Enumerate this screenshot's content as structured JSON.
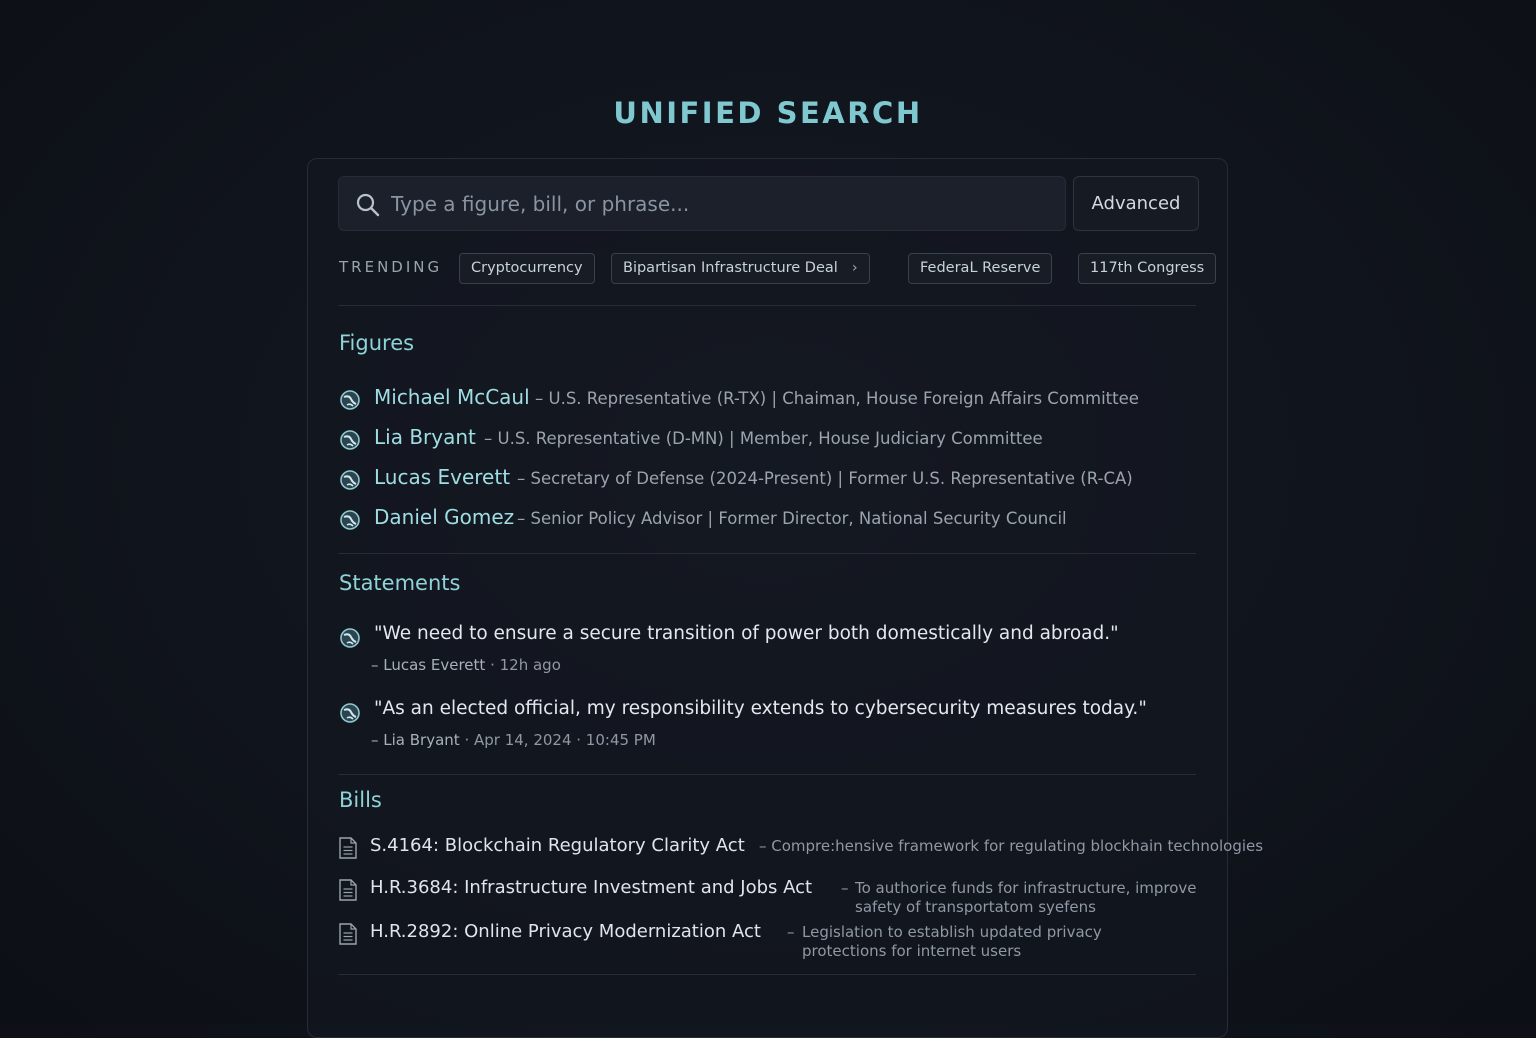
{
  "page": {
    "title": "UNIFIED SEARCH"
  },
  "search": {
    "placeholder": "Type a figure, bill, or phrase...",
    "value": "",
    "advanced_label": "Advanced"
  },
  "trending": {
    "label": "TRENDING",
    "chips": [
      {
        "label": "Cryptocurrency"
      },
      {
        "label": "Bipartisan Infrastructure Deal",
        "chevron": "›"
      },
      {
        "label": "FederaL Reserve"
      },
      {
        "label": "117th Congress"
      }
    ]
  },
  "figures": {
    "title": "Figures",
    "items": [
      {
        "name": "Michael McCaul",
        "desc": "– U.S. Representative (R-TX)  |  Chaiman, House Foreign Affairs Committee"
      },
      {
        "name": "Lia Bryant",
        "desc": "– U.S. Representative (D-MN)  |  Member, House Judiciary Committee"
      },
      {
        "name": "Lucas Everett",
        "desc": "– Secretary of Defense (2024-Present)  |  Former U.S. Representative (R-CA)"
      },
      {
        "name": "Daniel Gomez",
        "desc": "– Senior Policy Advisor  |  Former Director, National Security Council"
      }
    ]
  },
  "statements": {
    "title": "Statements",
    "items": [
      {
        "quote": "\"We need to ensure a secure transition of power both domestically and abroad.\"",
        "author": "– Lucas Everett",
        "time": "·  12h ago"
      },
      {
        "quote": "\"As an elected official, my responsibility extends to cybersecurity measures today.\"",
        "author": "– Lia Bryant",
        "time": "·  Apr 14, 2024 · 10:45 PM"
      }
    ]
  },
  "bills": {
    "title": "Bills",
    "items": [
      {
        "title": "S.4164: Blockchain Regulatory Clarity Act",
        "desc": "– Compre:hensive framework for regulating blockhain technologies"
      },
      {
        "title": "H.R.3684: Infrastructure Investment and Jobs Act",
        "desc_dash": "–",
        "desc_line1": "To authorice funds for infrastructure, improve",
        "desc_line2": "safety of transportatom syefens"
      },
      {
        "title": "H.R.2892: Online Privacy Modernization Act",
        "desc_dash": "–",
        "desc_line1": "Legislation to establish updated privacy",
        "desc_line2": "protections for internet users"
      }
    ]
  },
  "colors": {
    "accent": "#7fc8cf",
    "name": "#9fdde3",
    "background": "#10141c"
  },
  "icons": {
    "search": "search-icon",
    "figure": "globe-icon",
    "bill": "document-icon"
  }
}
